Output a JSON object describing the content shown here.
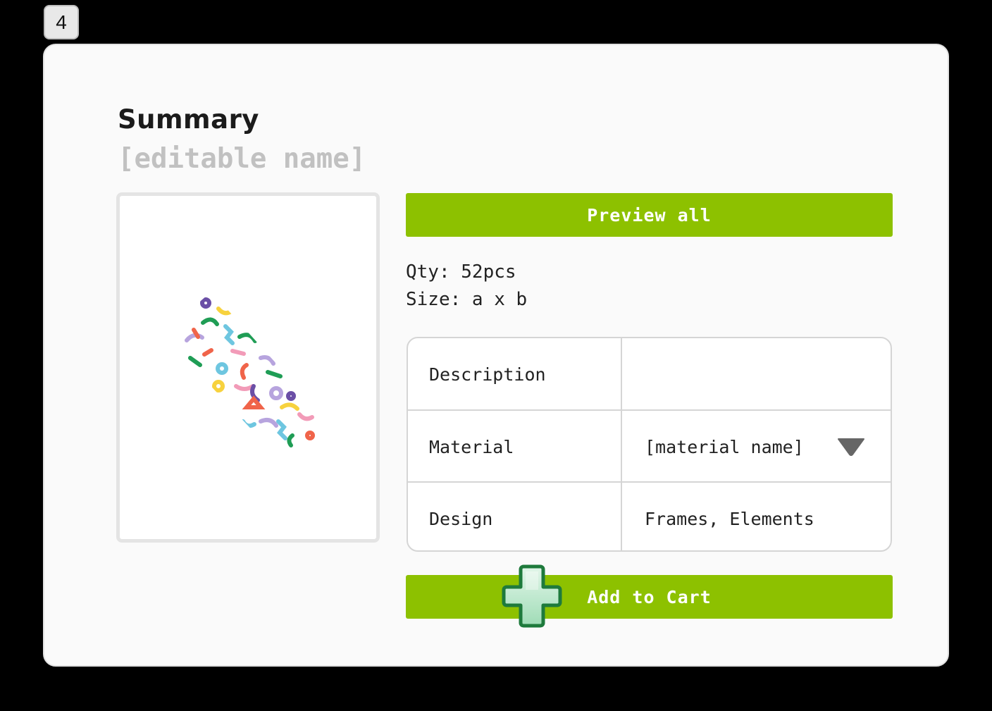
{
  "step": {
    "number": "4"
  },
  "summary": {
    "title": "Summary",
    "name_placeholder": "[editable name]"
  },
  "actions": {
    "preview_label": "Preview all",
    "add_to_cart_label": "Add to Cart",
    "add_icon": "plus-icon"
  },
  "details": {
    "qty": "Qty: 52pcs",
    "size": "Size: a x b"
  },
  "specs": {
    "rows": [
      {
        "label": "Description",
        "value": ""
      },
      {
        "label": "Material",
        "value": "[material name]",
        "control": "dropdown"
      },
      {
        "label": "Design",
        "value": "Frames, Elements"
      }
    ]
  },
  "colors": {
    "accent": "#8dc100",
    "card_bg": "#fafafa",
    "placeholder_text": "#c1c1c1",
    "plus_green": "#1e7a3c",
    "plus_fill": "#bfe9cf"
  }
}
